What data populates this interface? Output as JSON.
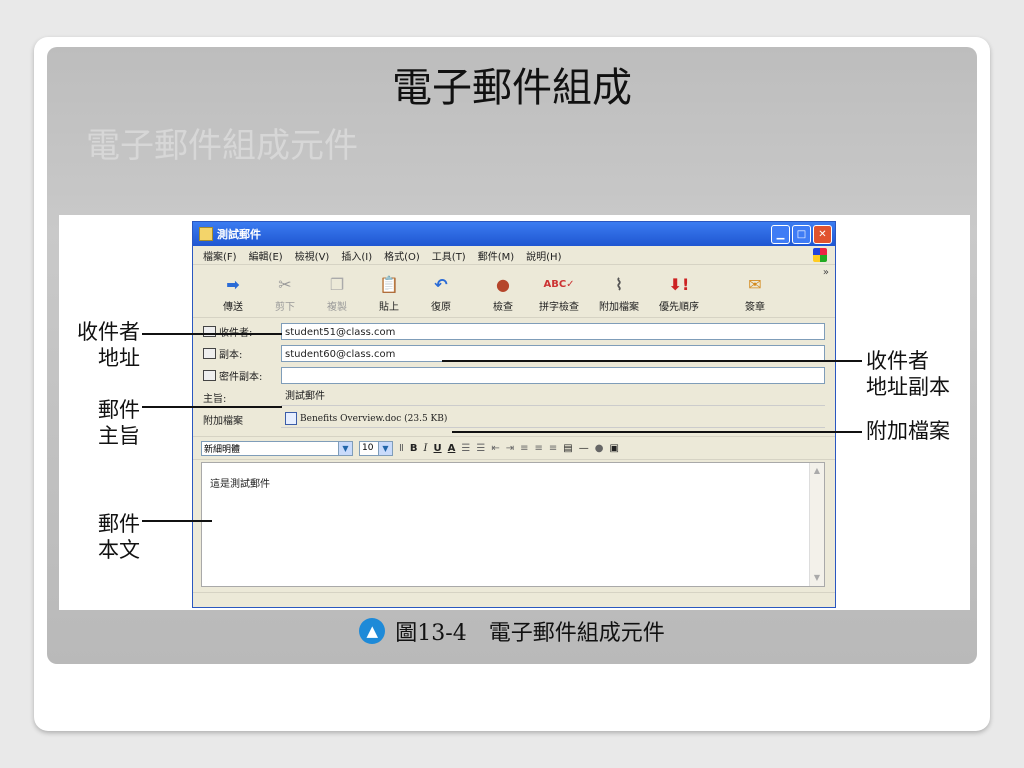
{
  "slide": {
    "title": "電子郵件組成",
    "subtitle": "電子郵件組成元件",
    "caption_number": "圖13-4",
    "caption_text": "電子郵件組成元件"
  },
  "window": {
    "title": "測試郵件",
    "menu": [
      "檔案(F)",
      "編輯(E)",
      "檢視(V)",
      "插入(I)",
      "格式(O)",
      "工具(T)",
      "郵件(M)",
      "說明(H)"
    ],
    "toolbar": [
      {
        "label": "傳送",
        "icon": "send-icon",
        "enabled": true
      },
      {
        "label": "剪下",
        "icon": "scissors-icon",
        "enabled": false
      },
      {
        "label": "複製",
        "icon": "copy-icon",
        "enabled": false
      },
      {
        "label": "貼上",
        "icon": "paste-icon",
        "enabled": true
      },
      {
        "label": "復原",
        "icon": "undo-icon",
        "enabled": true
      },
      {
        "label": "檢查",
        "icon": "check-names-icon",
        "enabled": true
      },
      {
        "label": "拼字檢查",
        "icon": "spellcheck-icon",
        "enabled": true
      },
      {
        "label": "附加檔案",
        "icon": "paperclip-icon",
        "enabled": true
      },
      {
        "label": "優先順序",
        "icon": "priority-icon",
        "enabled": true
      },
      {
        "label": "簽章",
        "icon": "sign-icon",
        "enabled": true
      }
    ],
    "fields": {
      "to_label": "收件者:",
      "to_value": "student51@class.com",
      "cc_label": "副本:",
      "cc_value": "student60@class.com",
      "bcc_label": "密件副本:",
      "bcc_value": "",
      "subject_label": "主旨:",
      "subject_value": "測試郵件",
      "attach_label": "附加檔案",
      "attach_value": "Benefits Overview.doc (23.5 KB)"
    },
    "format": {
      "font": "新細明體",
      "size": "10",
      "bold": "B",
      "italic": "I",
      "underline": "U",
      "color": "A"
    },
    "body_text": "這是測試郵件"
  },
  "callouts": {
    "to_line1": "收件者",
    "to_line2": "地址",
    "subject_line1": "郵件",
    "subject_line2": "主旨",
    "body_line1": "郵件",
    "body_line2": "本文",
    "cc_line1": "收件者",
    "cc_line2": "地址副本",
    "attach": "附加檔案"
  }
}
